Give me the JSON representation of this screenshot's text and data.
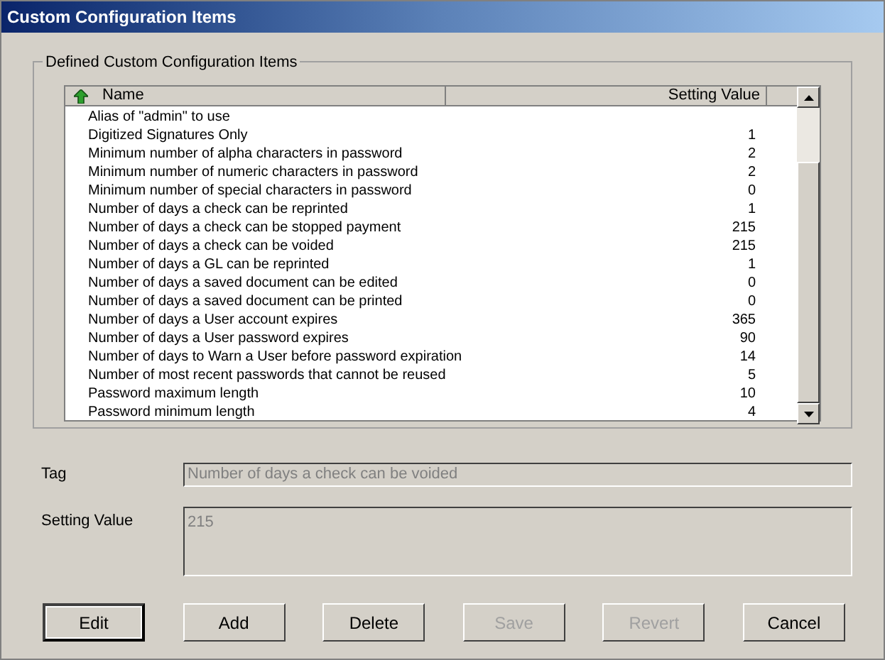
{
  "window": {
    "title": "Custom Configuration Items"
  },
  "group": {
    "title": "Defined Custom Configuration Items"
  },
  "table": {
    "columns": [
      "Name",
      "Setting Value"
    ],
    "rows": [
      {
        "name": "Alias of \"admin\" to use",
        "value": ""
      },
      {
        "name": "Digitized Signatures Only",
        "value": "1"
      },
      {
        "name": "Minimum number of alpha characters in password",
        "value": "2"
      },
      {
        "name": "Minimum number of numeric characters in password",
        "value": "2"
      },
      {
        "name": "Minimum number of special characters in password",
        "value": "0"
      },
      {
        "name": "Number of days a check can be reprinted",
        "value": "1"
      },
      {
        "name": "Number of days a check can be stopped payment",
        "value": "215"
      },
      {
        "name": "Number of days a check can be voided",
        "value": "215"
      },
      {
        "name": "Number of days a GL can be reprinted",
        "value": "1"
      },
      {
        "name": "Number of days a saved document can be edited",
        "value": "0"
      },
      {
        "name": "Number of days a saved document can be printed",
        "value": "0"
      },
      {
        "name": "Number of days a User account expires",
        "value": "365"
      },
      {
        "name": "Number of days a User password expires",
        "value": "90"
      },
      {
        "name": "Number of days to Warn a User before password expiration",
        "value": "14"
      },
      {
        "name": "Number of most recent passwords that cannot be reused",
        "value": "5"
      },
      {
        "name": "Password maximum length",
        "value": "10"
      },
      {
        "name": "Password minimum length",
        "value": "4"
      }
    ]
  },
  "tag": {
    "label": "Tag",
    "value": "Number of days a check can be voided"
  },
  "setting_value": {
    "label": "Setting Value",
    "value": "215"
  },
  "buttons": [
    {
      "label": "Edit",
      "disabled": false,
      "default": true
    },
    {
      "label": "Add",
      "disabled": false,
      "default": false
    },
    {
      "label": "Delete",
      "disabled": false,
      "default": false
    },
    {
      "label": "Save",
      "disabled": true,
      "default": false
    },
    {
      "label": "Revert",
      "disabled": true,
      "default": false
    },
    {
      "label": "Cancel",
      "disabled": false,
      "default": false
    }
  ]
}
